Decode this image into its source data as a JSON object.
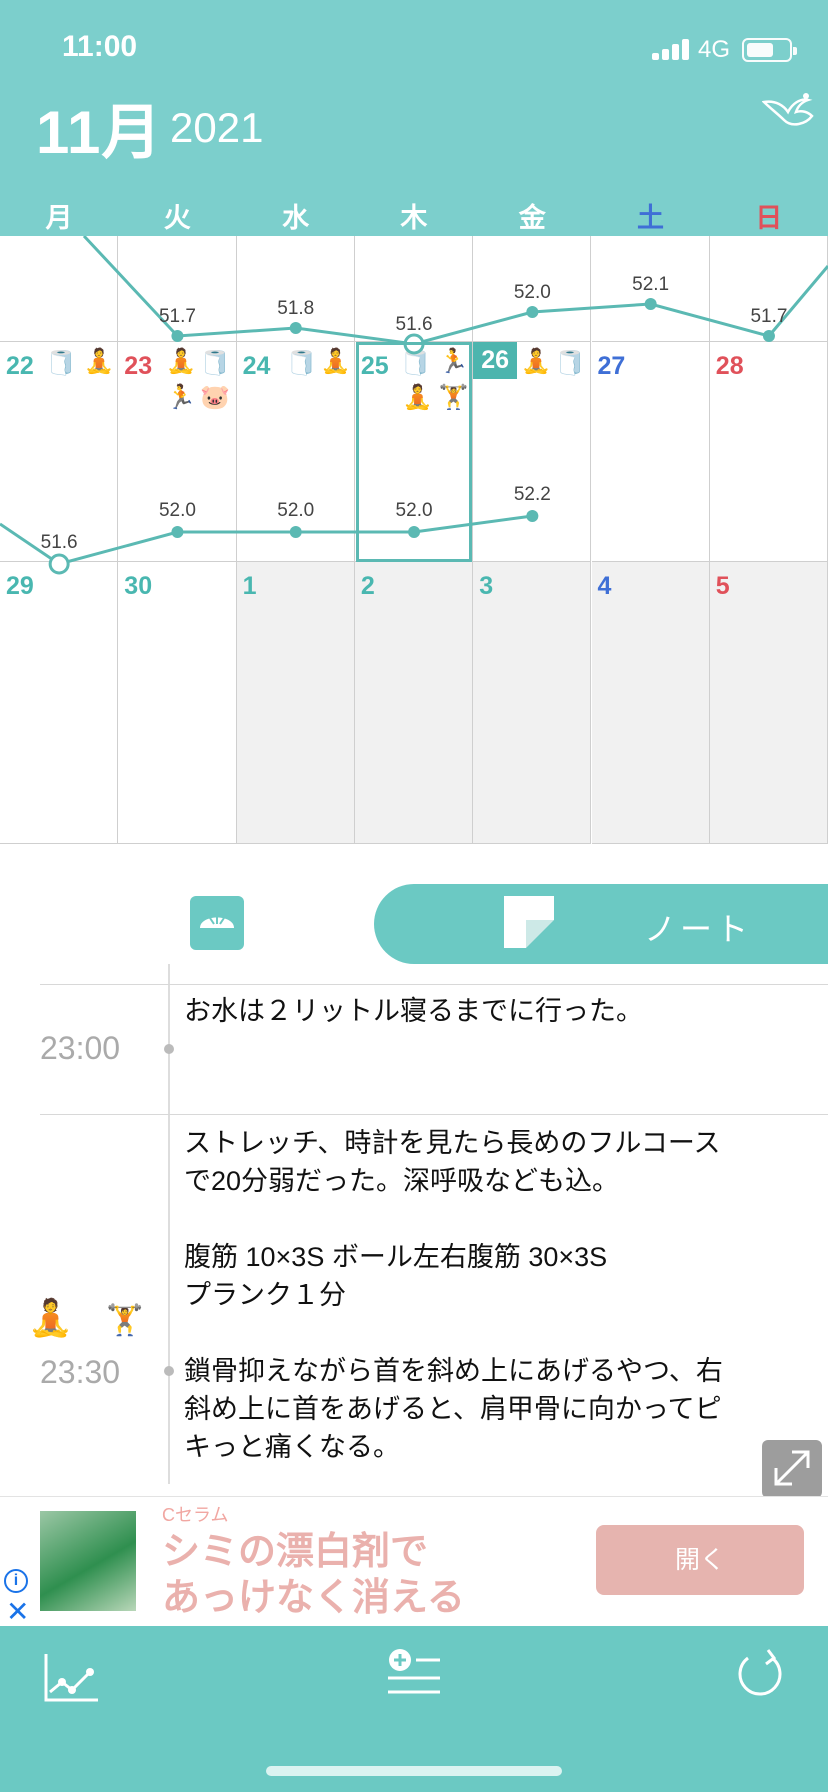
{
  "status": {
    "time": "11:00",
    "network": "4G"
  },
  "header": {
    "month": "11月",
    "year": "2021"
  },
  "weekdays": [
    {
      "label": "月",
      "color": "#ffffff"
    },
    {
      "label": "火",
      "color": "#ffffff"
    },
    {
      "label": "水",
      "color": "#ffffff"
    },
    {
      "label": "木",
      "color": "#ffffff"
    },
    {
      "label": "金",
      "color": "#ffffff"
    },
    {
      "label": "土",
      "color": "#3f6fd6"
    },
    {
      "label": "日",
      "color": "#e0515a"
    }
  ],
  "calendar": {
    "row1_weights": [
      "51.7",
      "51.8",
      "51.6",
      "52.0",
      "52.1",
      "51.7"
    ],
    "row2": {
      "days": [
        {
          "num": "22",
          "color": "#49b7b0"
        },
        {
          "num": "23",
          "color": "#e0515a"
        },
        {
          "num": "24",
          "color": "#49b7b0"
        },
        {
          "num": "25",
          "color": "#49b7b0"
        },
        {
          "num": "26",
          "color": "#ffffff"
        },
        {
          "num": "27",
          "color": "#3f6fd6"
        },
        {
          "num": "28",
          "color": "#e0515a"
        }
      ],
      "weights": [
        "51.6",
        "52.0",
        "52.0",
        "52.0",
        "52.2"
      ]
    },
    "row3": {
      "days": [
        {
          "num": "29",
          "color": "#49b7b0"
        },
        {
          "num": "30",
          "color": "#49b7b0"
        },
        {
          "num": "1",
          "color": "#49b7b0"
        },
        {
          "num": "2",
          "color": "#49b7b0"
        },
        {
          "num": "3",
          "color": "#49b7b0"
        },
        {
          "num": "4",
          "color": "#3f6fd6"
        },
        {
          "num": "5",
          "color": "#e0515a"
        }
      ]
    }
  },
  "tabs": {
    "note_label": "ノート"
  },
  "timeline": [
    {
      "time": "23:00",
      "text": "お水は２リットル寝るまでに行った。"
    },
    {
      "time": "23:30",
      "text": "ストレッチ、時計を見たら長めのフルコース\nで20分弱だった。深呼吸なども込。\n\n腹筋 10×3S ボール左右腹筋 30×3S\nプランク１分\n\n鎖骨抑えながら首を斜め上にあげるやつ、右\n斜め上に首をあげると、肩甲骨に向かってピ\nキっと痛くなる。"
    }
  ],
  "ad": {
    "brand": "Cセラム",
    "line1": "シミの漂白剤で",
    "line2": "あっけなく消える",
    "button": "開く"
  },
  "colors": {
    "accent": "#7ccfcc",
    "teal_dark": "#4db5ae",
    "saturday": "#3f6fd6",
    "sunday": "#e0515a"
  }
}
